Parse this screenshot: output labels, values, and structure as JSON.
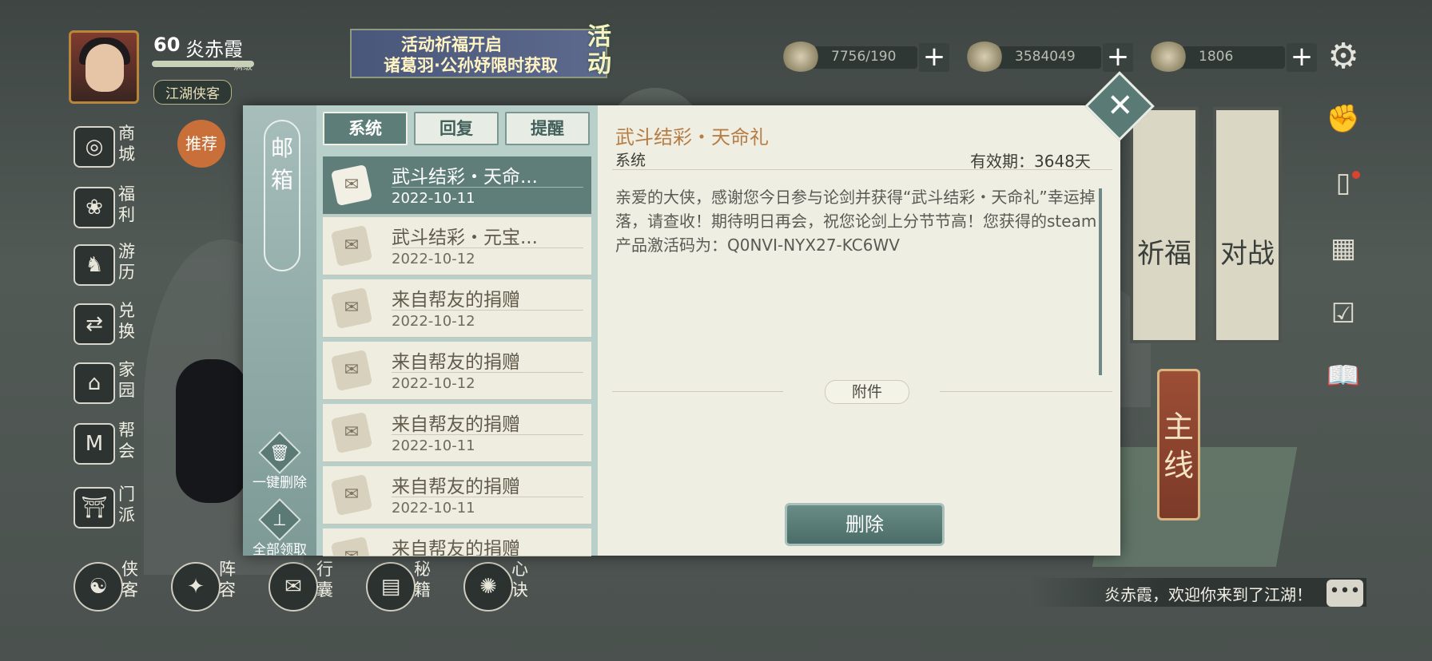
{
  "player": {
    "level": "60",
    "name": "炎赤霞",
    "level_tag": "满级",
    "title": "江湖侠客"
  },
  "event_banner": {
    "line1": "活动祈福开启",
    "line2": "诸葛羽·公孙妤限时获取",
    "side": "活动"
  },
  "resources": [
    {
      "icon": "bun-icon",
      "value": "7756/190"
    },
    {
      "icon": "coin-stack-icon",
      "value": "3584049"
    },
    {
      "icon": "gold-ingot-icon",
      "value": "1806"
    }
  ],
  "left_menu": [
    {
      "icon": "shop-icon",
      "label": "商城"
    },
    {
      "icon": "welfare-icon",
      "label": "福利"
    },
    {
      "icon": "horse-icon",
      "label": "游历"
    },
    {
      "icon": "exchange-icon",
      "label": "兑换"
    },
    {
      "icon": "home-icon",
      "label": "家园"
    },
    {
      "icon": "guild-icon",
      "label": "帮会"
    },
    {
      "icon": "sect-icon",
      "label": "门派"
    }
  ],
  "recommend_label": "推荐",
  "bottom_menu": [
    {
      "icon": "hero-icon",
      "label": "侠客"
    },
    {
      "icon": "formation-icon",
      "label": "阵容"
    },
    {
      "icon": "bag-icon",
      "label": "行囊"
    },
    {
      "icon": "manual-icon",
      "label": "秘籍"
    },
    {
      "icon": "mind-icon",
      "label": "心诀"
    }
  ],
  "banners": {
    "pray": "祈福",
    "battle": "对战",
    "main_line": "主线"
  },
  "chat_message": "炎赤霞，欢迎你来到了江湖！",
  "mailbox": {
    "title": "邮箱",
    "delete_all_label": "一键删除",
    "claim_all_label": "全部领取",
    "tabs": [
      "系统",
      "回复",
      "提醒"
    ],
    "active_tab": "系统",
    "mails": [
      {
        "title": "武斗结彩・天命...",
        "date": "2022-10-11",
        "selected": true
      },
      {
        "title": "武斗结彩・元宝...",
        "date": "2022-10-12",
        "selected": false
      },
      {
        "title": "来自帮友的捐赠",
        "date": "2022-10-12",
        "selected": false
      },
      {
        "title": "来自帮友的捐赠",
        "date": "2022-10-12",
        "selected": false
      },
      {
        "title": "来自帮友的捐赠",
        "date": "2022-10-11",
        "selected": false
      },
      {
        "title": "来自帮友的捐赠",
        "date": "2022-10-11",
        "selected": false
      },
      {
        "title": "来自帮友的捐赠",
        "date": "",
        "selected": false
      }
    ],
    "detail": {
      "title": "武斗结彩・天命礼",
      "sender": "系统",
      "validity": "有效期：3648天",
      "body": "亲爱的大侠，感谢您今日参与论剑并获得“武斗结彩・天命礼”幸运掉落，请查收！期待明日再会，祝您论剑上分节节高！您获得的steam产品激活码为：Q0NVI-NYX27-KC6WV",
      "attachment_label": "附件",
      "delete_label": "删除"
    }
  },
  "colors": {
    "panel": "#efeee2",
    "accent": "#5f7e79",
    "title_accent": "#b77d46"
  }
}
